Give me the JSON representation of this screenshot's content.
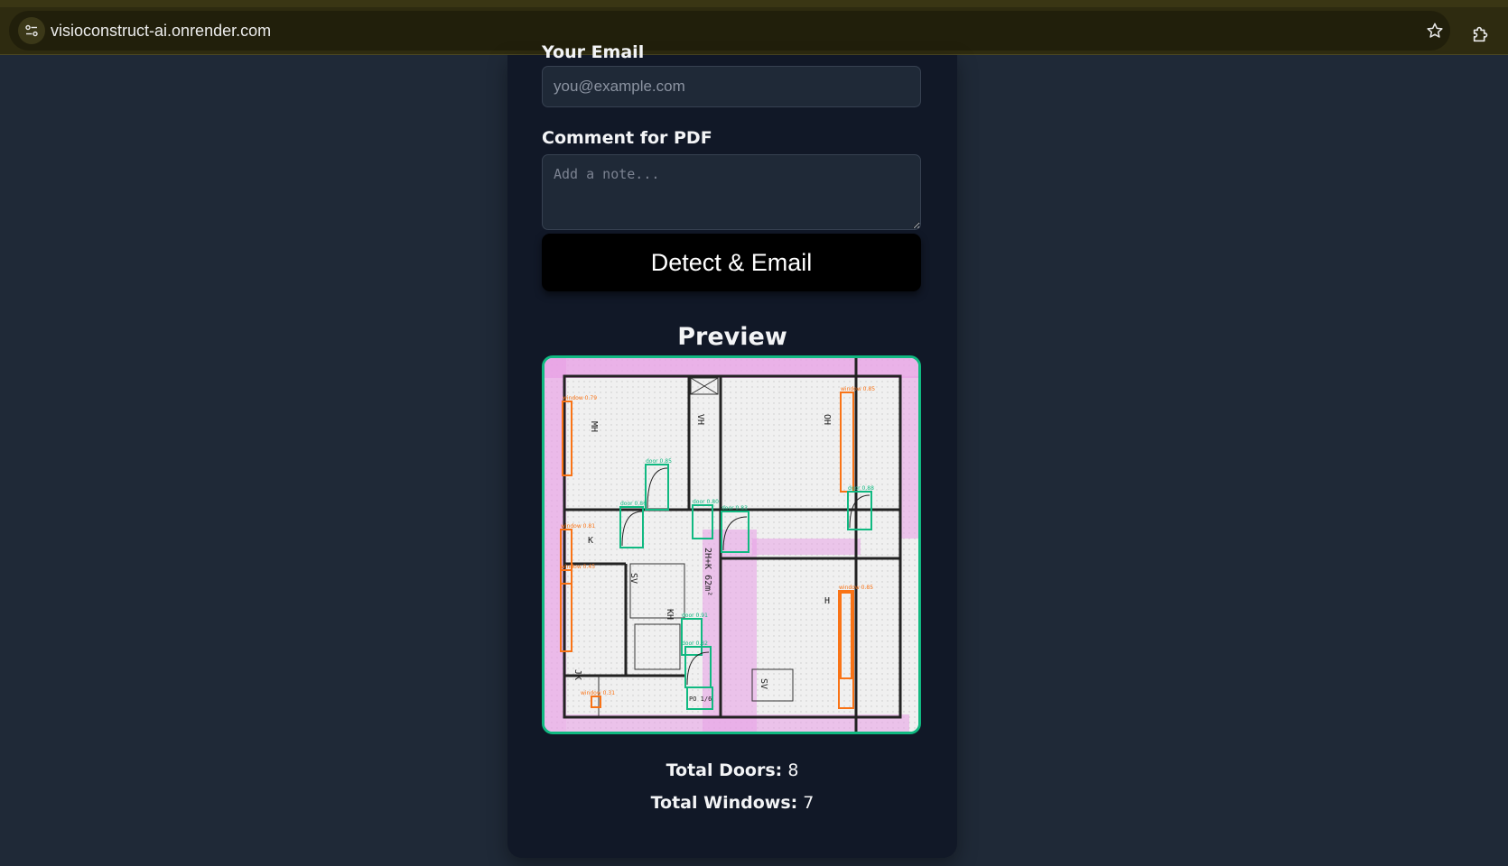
{
  "browser": {
    "url": "visioconstruct-ai.onrender.com"
  },
  "form": {
    "email_label": "Your Email",
    "email_placeholder": "you@example.com",
    "comment_label": "Comment for PDF",
    "comment_placeholder": "Add a note...",
    "submit_label": "Detect & Email"
  },
  "preview": {
    "title": "Preview",
    "image_alt": "floor plan with detected doors and windows",
    "door_color": "#10b981",
    "window_color": "#f97316",
    "annotation_labels": [
      "window 0.79",
      "window 0.85",
      "door 0.85",
      "door 0.86",
      "door 0.80",
      "door 0.83",
      "door 0.88",
      "window 0.81",
      "window 0.45",
      "window 0.85",
      "door 0.91",
      "door 0.82",
      "window 0.31"
    ],
    "plan_labels": [
      "MH",
      "VH",
      "OH",
      "K",
      "SV",
      "KH",
      "H",
      "JK",
      "SV",
      "2H+K 62m²",
      "PO 1/6"
    ]
  },
  "stats": {
    "doors_label": "Total Doors:",
    "doors_value": "8",
    "windows_label": "Total Windows:",
    "windows_value": "7"
  },
  "theme": {
    "page_bg": "#1f2937",
    "card_bg": "#111827",
    "accent": "#10b981"
  }
}
